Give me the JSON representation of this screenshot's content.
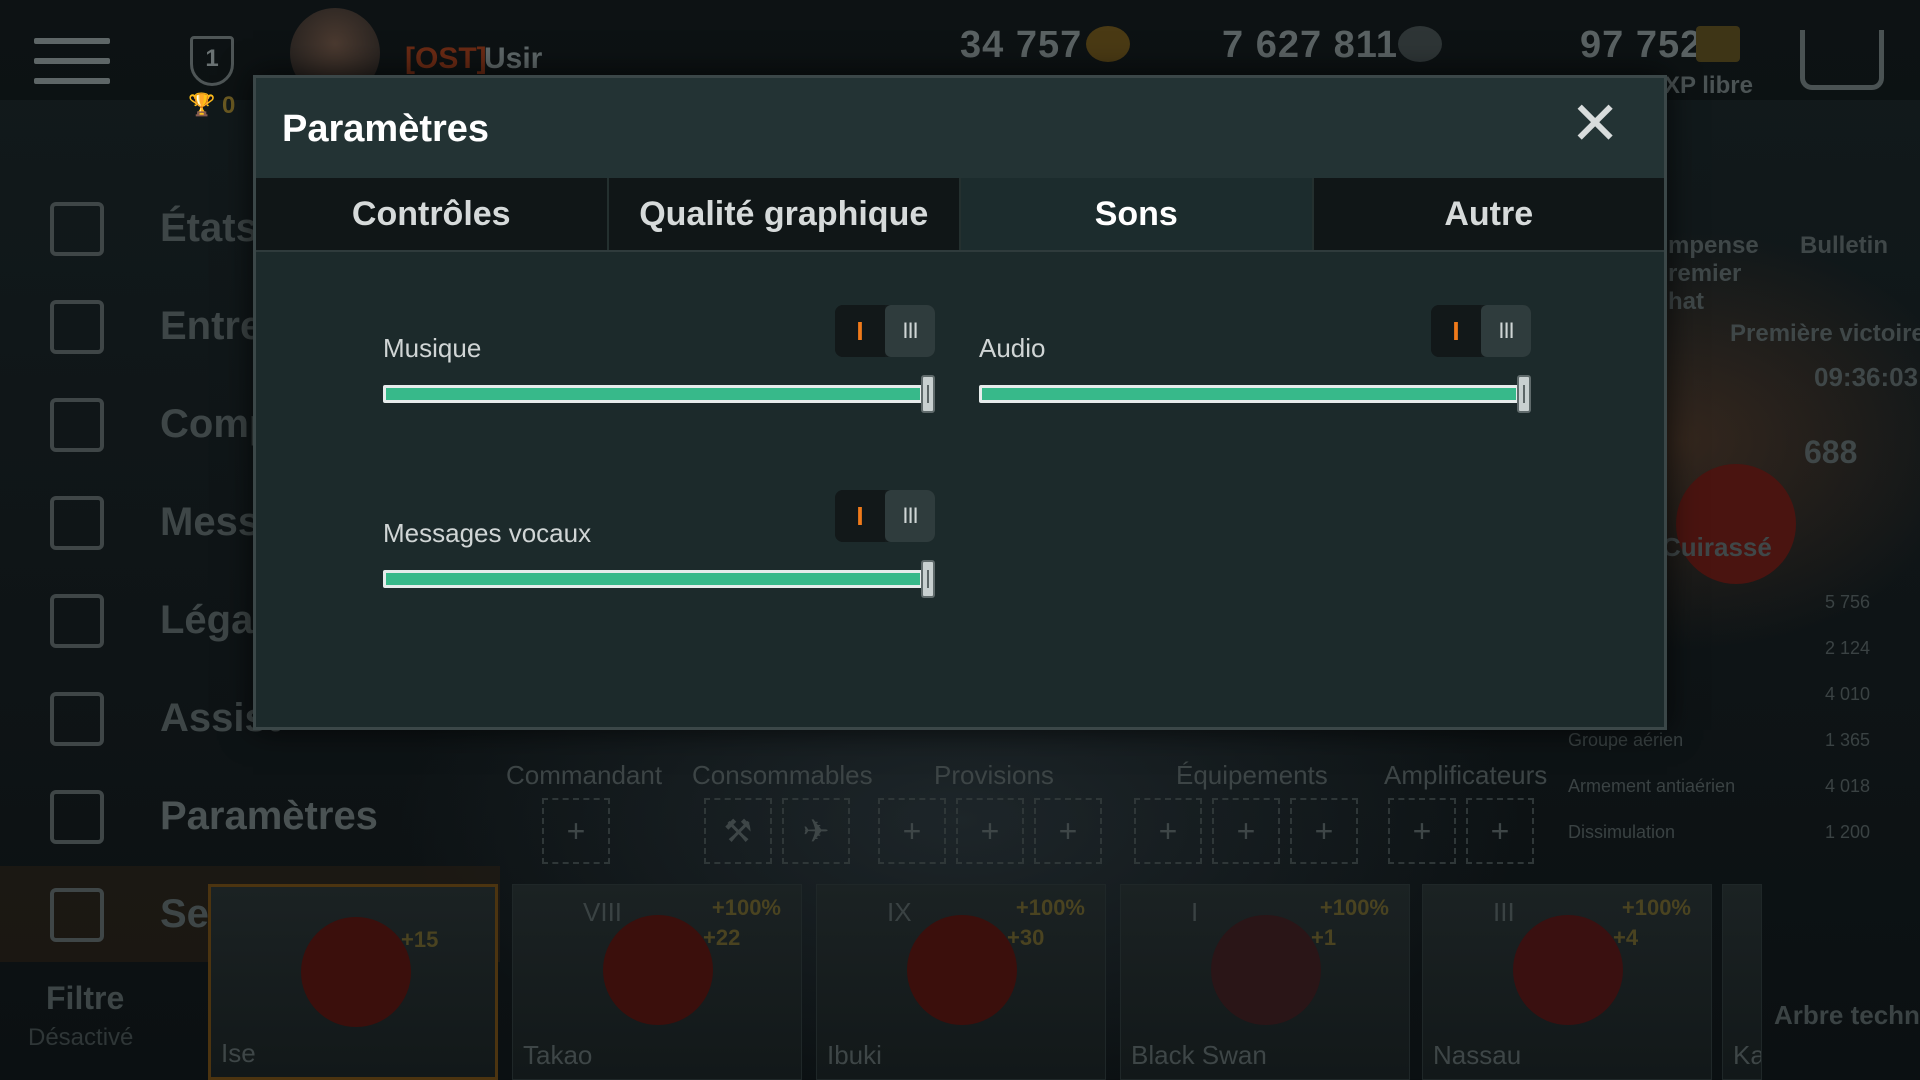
{
  "background": {
    "rank_level": "1",
    "trophy_count": "0",
    "clan_tag": "[OST]",
    "username": "Usir",
    "credits": "34 757",
    "silver": "7 627 811",
    "free_xp": "97 752",
    "free_xp_label": "XP libre",
    "menu": [
      {
        "label": "États"
      },
      {
        "label": "Entrep"
      },
      {
        "label": "Comp"
      },
      {
        "label": "Mess"
      },
      {
        "label": "Légal"
      },
      {
        "label": "Assist"
      },
      {
        "label": "Paramètres"
      },
      {
        "label": "Se déconnecter"
      }
    ],
    "right_panel": {
      "reward_label_1": "mpense",
      "reward_label_2": "remier",
      "reward_label_3": "hat",
      "bulletin": "Bulletin",
      "first_victory": "Première victoire",
      "timer": "09:36:03",
      "stars": "688",
      "ship_class": "Cuirassé",
      "stats": [
        {
          "label": "",
          "value": "5 756"
        },
        {
          "label": "",
          "value": "2 124"
        },
        {
          "label": "",
          "value": "4 010"
        },
        {
          "label": "Groupe aérien",
          "value": "1 365"
        },
        {
          "label": "Armement antiaérien",
          "value": "4 018"
        },
        {
          "label": "Dissimulation",
          "value": "1 200"
        }
      ]
    },
    "equipment_labels": [
      "Commandant",
      "Consommables",
      "Provisions",
      "Équipements",
      "Amplificateurs"
    ],
    "ships": [
      {
        "name": "Ise",
        "tier": "",
        "bonus": "",
        "trophy": "+15"
      },
      {
        "name": "Takao",
        "tier": "VIII",
        "bonus": "+100%",
        "trophy": "+22"
      },
      {
        "name": "Ibuki",
        "tier": "IX",
        "bonus": "+100%",
        "trophy": "+30"
      },
      {
        "name": "Black Swan",
        "tier": "I",
        "bonus": "+100%",
        "trophy": "+1"
      },
      {
        "name": "Nassau",
        "tier": "III",
        "bonus": "+100%",
        "trophy": "+4"
      },
      {
        "name": "Kai",
        "tier": "",
        "bonus": "",
        "trophy": ""
      }
    ],
    "filter_label": "Filtre",
    "filter_sub": "Désactivé",
    "tech_tree": "Arbre techno"
  },
  "modal": {
    "title": "Paramètres",
    "close_icon": "close-icon",
    "tabs": [
      {
        "label": "Contrôles",
        "active": false
      },
      {
        "label": "Qualité graphique",
        "active": false
      },
      {
        "label": "Sons",
        "active": true
      },
      {
        "label": "Autre",
        "active": false
      }
    ],
    "controls": [
      {
        "label": "Musique",
        "value": 1.0,
        "mode_single": "I",
        "mode_triple": "III"
      },
      {
        "label": "Audio",
        "value": 1.0,
        "mode_single": "I",
        "mode_triple": "III"
      },
      {
        "label": "Messages vocaux",
        "value": 1.0,
        "mode_single": "I",
        "mode_triple": "III"
      }
    ]
  },
  "colors": {
    "accent_green": "#37b98a",
    "accent_orange": "#f07a1a",
    "modal_bg": "#1c2a2b"
  }
}
